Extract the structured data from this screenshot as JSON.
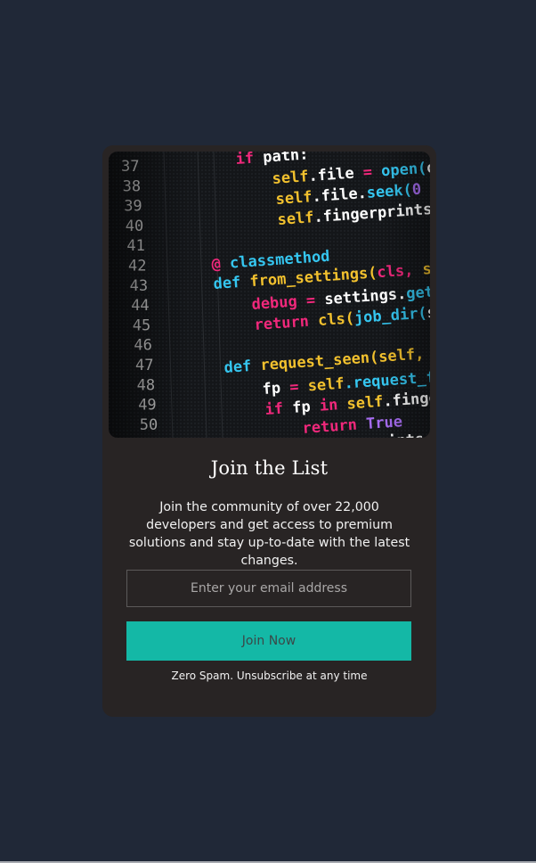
{
  "signup": {
    "title": "Join the List",
    "description": "Join the community of over 22,000 developers and get access to premium solutions and stay up-to-date with the latest changes.",
    "email_placeholder": "Enter your email address",
    "email_value": "",
    "button_label": "Join Now",
    "note": "Zero Spam. Unsubscribe at any time"
  },
  "hero_image": {
    "subject": "code-screenshot",
    "line_numbers": [
      "37",
      "38",
      "39",
      "40",
      "41",
      "42",
      "43",
      "44",
      "45",
      "46",
      "47",
      "48",
      "49",
      "50"
    ],
    "code_tokens": [
      [
        "if",
        "path:"
      ],
      [
        "self",
        ".file",
        "=",
        "open(",
        "o"
      ],
      [
        "self",
        ".file.",
        "seek(",
        "0",
        ")"
      ],
      [
        "self",
        ".fingerprints."
      ],
      [],
      [
        "@",
        "classmethod"
      ],
      [
        "def",
        "from_settings(",
        "cls,",
        "se"
      ],
      [
        "debug",
        "=",
        "settings.",
        "get"
      ],
      [
        "return",
        "cls(",
        "job_dir(",
        "s"
      ],
      [],
      [
        "def",
        "request_seen(",
        "self,",
        "r"
      ],
      [
        "fp",
        "=",
        "self",
        ".request_f"
      ],
      [
        "if",
        "fp",
        "in",
        "self",
        ".finge"
      ],
      [
        "return",
        "True"
      ],
      [
        "self",
        ".fingerprints.",
        "a"
      ]
    ]
  },
  "colors": {
    "page_background": "#202837",
    "card_background": "#282424",
    "accent": "#14b8a6",
    "code_pink": "#f0287b",
    "code_yellow": "#f2c12e",
    "code_cyan": "#35c6f0",
    "code_purple": "#a66cf0"
  }
}
